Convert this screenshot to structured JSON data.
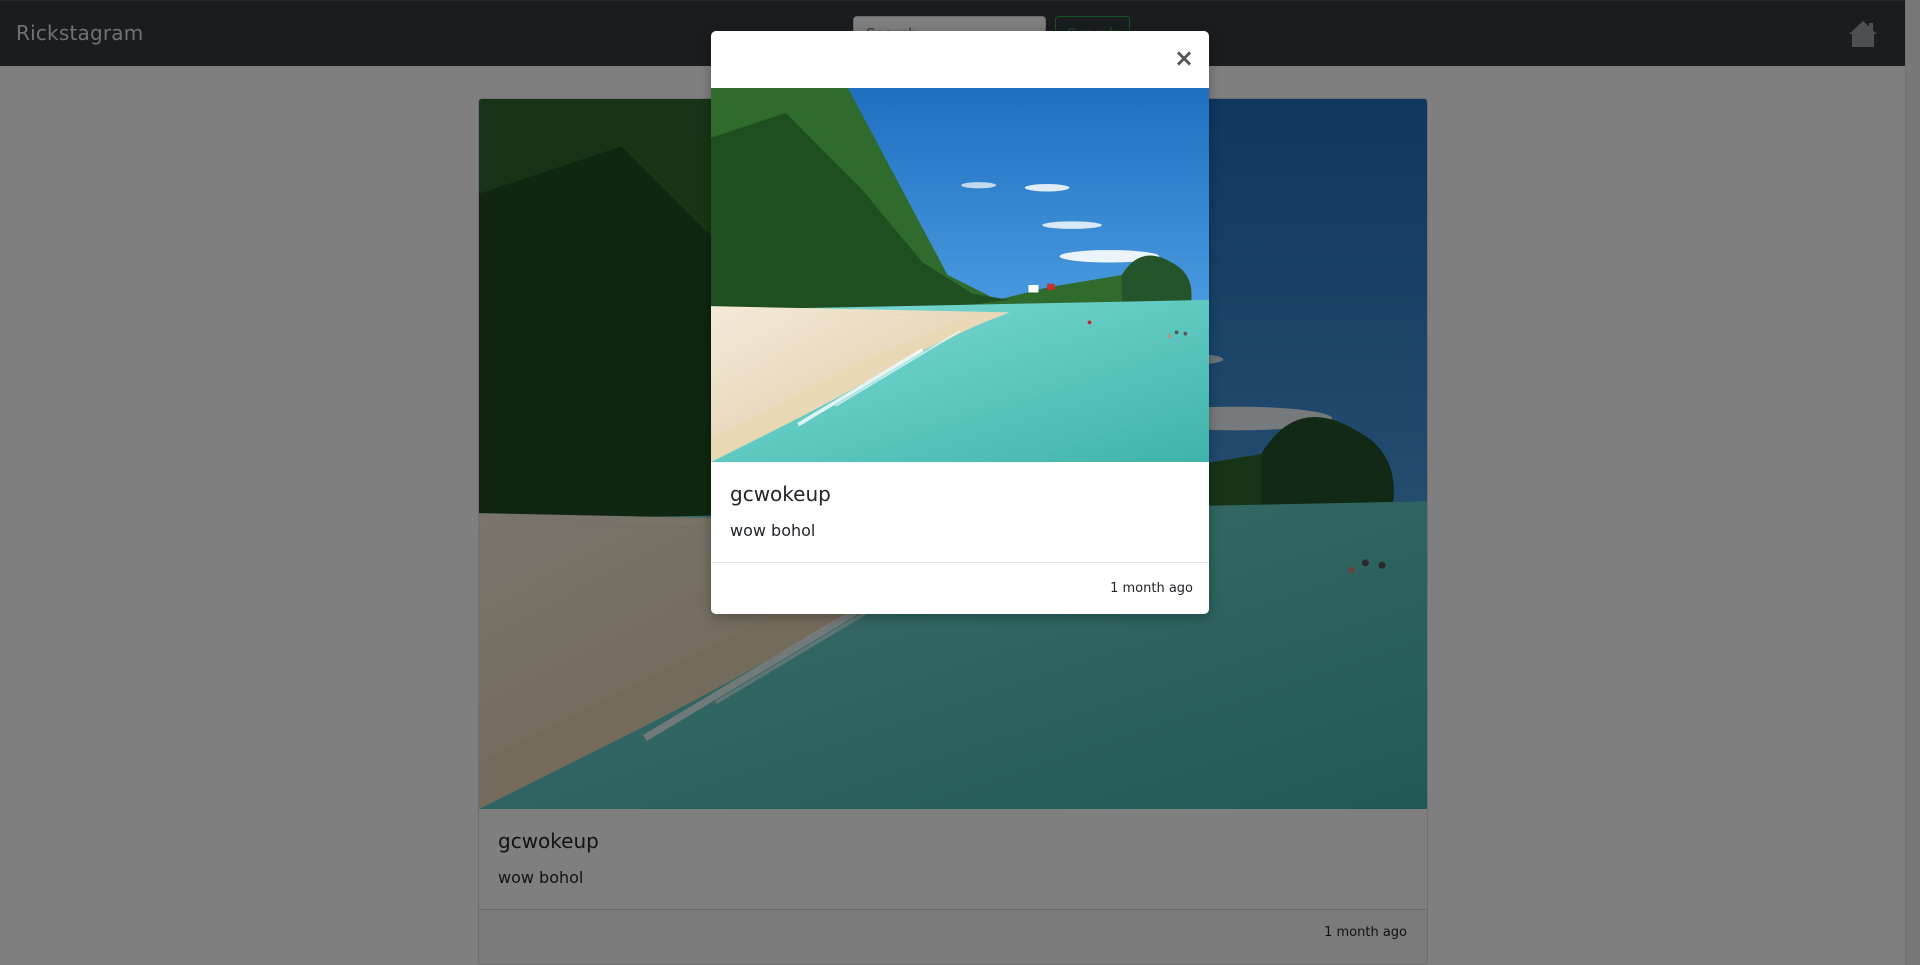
{
  "navbar": {
    "brand": "Rickstagram",
    "search": {
      "placeholder": "Search",
      "value": ""
    },
    "search_button_label": "Search",
    "home_icon": "home-icon"
  },
  "feed": {
    "posts": [
      {
        "username": "gcwokeup",
        "caption": "wow bohol",
        "timestamp": "1 month ago",
        "image": "beach-photo"
      }
    ]
  },
  "modal": {
    "close_label": "×",
    "username": "gcwokeup",
    "caption": "wow bohol",
    "timestamp": "1 month ago",
    "image": "beach-photo"
  },
  "colors": {
    "navbar_bg": "#343a40",
    "success": "#28a745",
    "backdrop": "rgba(0,0,0,0.5)"
  }
}
